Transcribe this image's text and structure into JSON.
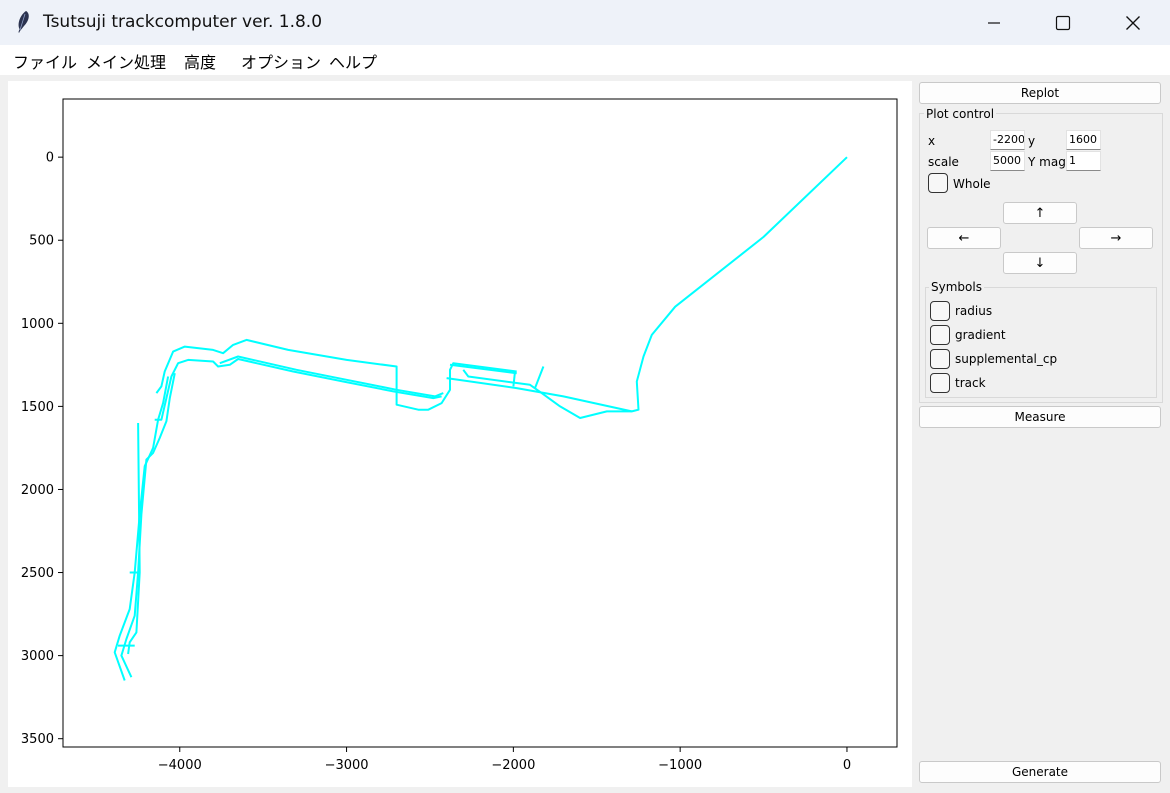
{
  "window": {
    "title": "Tsutsuji trackcomputer ver. 1.8.0",
    "icon": "feather-icon"
  },
  "menu": [
    "ファイル",
    "メイン処理",
    "高度",
    "オプション",
    "ヘルプ"
  ],
  "side": {
    "replot_label": "Replot",
    "plot_control": {
      "label": "Plot control",
      "x_label": "x",
      "x_value": "-2200",
      "y_label": "y",
      "y_value": "1600",
      "scale_label": "scale",
      "scale_value": "5000",
      "ymag_label": "Y mag.",
      "ymag_value": "1",
      "whole_label": "Whole",
      "whole_checked": false,
      "up": "↑",
      "left": "←",
      "right": "→",
      "down": "↓"
    },
    "symbols": {
      "label": "Symbols",
      "items": [
        {
          "label": "radius",
          "checked": false
        },
        {
          "label": "gradient",
          "checked": false
        },
        {
          "label": "supplemental_cp",
          "checked": false
        },
        {
          "label": "track",
          "checked": false
        }
      ]
    },
    "measure_label": "Measure",
    "generate_label": "Generate"
  },
  "chart_data": {
    "type": "line",
    "x_ticks": [
      -4000,
      -3000,
      -2000,
      -1000,
      0
    ],
    "x_tick_labels": [
      "−4000",
      "−3000",
      "−2000",
      "−1000",
      "0"
    ],
    "y_ticks": [
      0,
      500,
      1000,
      1500,
      2000,
      2500,
      3000,
      3500
    ],
    "y_tick_labels": [
      "0",
      "500",
      "1000",
      "1500",
      "2000",
      "2500",
      "3000",
      "3500"
    ],
    "xlim": [
      -4700,
      300
    ],
    "ylim": [
      3550,
      -350
    ],
    "y_inverted": true,
    "grid": false,
    "line_color": "#00ffff",
    "series": [
      {
        "points": [
          [
            0,
            0
          ],
          [
            -500,
            480
          ],
          [
            -1030,
            900
          ],
          [
            -1170,
            1070
          ],
          [
            -1220,
            1200
          ],
          [
            -1260,
            1350
          ],
          [
            -1250,
            1520
          ],
          [
            -1290,
            1530
          ],
          [
            -1440,
            1530
          ],
          [
            -1600,
            1570
          ],
          [
            -1720,
            1500
          ],
          [
            -1830,
            1420
          ],
          [
            -1900,
            1370
          ],
          [
            -2270,
            1320
          ],
          [
            -2300,
            1280
          ]
        ]
      },
      {
        "points": [
          [
            -1290,
            1530
          ],
          [
            -1700,
            1440
          ],
          [
            -1980,
            1390
          ],
          [
            -2400,
            1330
          ]
        ]
      },
      {
        "points": [
          [
            -1820,
            1260
          ],
          [
            -1870,
            1390
          ]
        ]
      },
      {
        "points": [
          [
            -1990,
            1290
          ],
          [
            -2000,
            1380
          ]
        ]
      },
      {
        "points": [
          [
            -1980,
            1290
          ],
          [
            -2360,
            1240
          ],
          [
            -2380,
            1280
          ],
          [
            -2380,
            1400
          ],
          [
            -2430,
            1480
          ],
          [
            -2510,
            1520
          ],
          [
            -2570,
            1520
          ],
          [
            -2700,
            1490
          ],
          [
            -2700,
            1260
          ],
          [
            -3000,
            1220
          ],
          [
            -3350,
            1160
          ],
          [
            -3600,
            1100
          ],
          [
            -3680,
            1130
          ],
          [
            -3740,
            1180
          ],
          [
            -3800,
            1160
          ],
          [
            -3970,
            1140
          ],
          [
            -4040,
            1170
          ],
          [
            -4090,
            1290
          ],
          [
            -4110,
            1380
          ],
          [
            -4140,
            1420
          ]
        ]
      },
      {
        "points": [
          [
            -1980,
            1300
          ],
          [
            -2380,
            1250
          ]
        ]
      },
      {
        "points": [
          [
            -2420,
            1420
          ],
          [
            -2470,
            1440
          ],
          [
            -2700,
            1400
          ],
          [
            -3000,
            1340
          ],
          [
            -3300,
            1280
          ],
          [
            -3650,
            1200
          ],
          [
            -3760,
            1240
          ]
        ]
      },
      {
        "points": [
          [
            -2430,
            1440
          ],
          [
            -2480,
            1450
          ],
          [
            -2720,
            1410
          ],
          [
            -3020,
            1350
          ],
          [
            -3320,
            1290
          ],
          [
            -3650,
            1215
          ],
          [
            -3700,
            1250
          ],
          [
            -3770,
            1260
          ],
          [
            -3800,
            1230
          ],
          [
            -3950,
            1220
          ],
          [
            -4010,
            1240
          ],
          [
            -4050,
            1320
          ],
          [
            -4080,
            1450
          ],
          [
            -4110,
            1580
          ],
          [
            -4150,
            1580
          ]
        ]
      },
      {
        "points": [
          [
            -4030,
            1300
          ],
          [
            -4060,
            1450
          ],
          [
            -4080,
            1590
          ],
          [
            -4120,
            1690
          ],
          [
            -4160,
            1780
          ],
          [
            -4200,
            1820
          ],
          [
            -4230,
            2150
          ],
          [
            -4250,
            2500
          ],
          [
            -4270,
            2760
          ],
          [
            -4320,
            2900
          ],
          [
            -4350,
            3000
          ],
          [
            -4290,
            3130
          ]
        ]
      },
      {
        "points": [
          [
            -4070,
            1320
          ],
          [
            -4100,
            1480
          ],
          [
            -4130,
            1580
          ],
          [
            -4160,
            1750
          ],
          [
            -4210,
            1860
          ],
          [
            -4240,
            2150
          ],
          [
            -4270,
            2500
          ],
          [
            -4300,
            2720
          ],
          [
            -4360,
            2880
          ],
          [
            -4390,
            2980
          ],
          [
            -4330,
            3150
          ]
        ]
      },
      {
        "points": [
          [
            -4250,
            1600
          ],
          [
            -4240,
            2500
          ],
          [
            -4260,
            2860
          ],
          [
            -4300,
            2920
          ],
          [
            -4310,
            2990
          ]
        ]
      },
      {
        "points": [
          [
            -4300,
            2500
          ],
          [
            -4250,
            2500
          ]
        ]
      },
      {
        "points": [
          [
            -4370,
            2940
          ],
          [
            -4270,
            2940
          ]
        ]
      }
    ]
  }
}
